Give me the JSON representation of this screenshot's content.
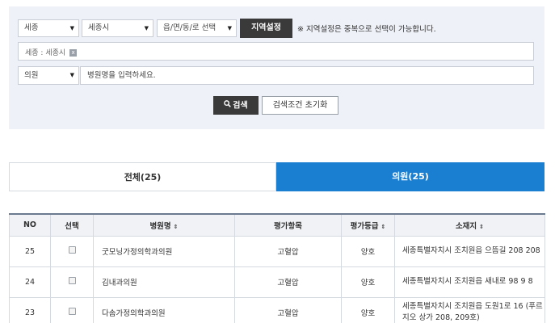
{
  "filters": {
    "sido": "세종",
    "sigungu": "세종시",
    "eupmyeondong": "읍/면/동/로 선택",
    "region_button": "지역설정",
    "note": "※ 지역설정은 중복으로 선택이 가능합니다.",
    "selected_region": "세종 : 세종시",
    "chip_remove": "x",
    "type": "의원",
    "name_placeholder": "병원명을 입력하세요.",
    "search_button": "검색",
    "reset_button": "검색조건 초기화"
  },
  "tabs": [
    {
      "label": "전체(25)"
    },
    {
      "label": "의원(25)"
    }
  ],
  "table": {
    "headers": {
      "no": "NO",
      "select": "선택",
      "name": "병원명",
      "item": "평가항목",
      "grade": "평가등급",
      "address": "소재지"
    },
    "sort_icon": "⇕",
    "rows": [
      {
        "no": "25",
        "name": "굿모닝가정의학과의원",
        "item": "고혈압",
        "grade": "양호",
        "address": "세종특별자치시 조치원읍 으뜸길 208 208"
      },
      {
        "no": "24",
        "name": "김내과의원",
        "item": "고혈압",
        "grade": "양호",
        "address": "세종특별자치시 조치원읍 새내로 98 9 8"
      },
      {
        "no": "23",
        "name": "다솜가정의학과의원",
        "item": "고혈압",
        "grade": "양호",
        "address": "세종특별자치시 조치원읍 도원1로 16 (푸르지오 상가 208, 209호)"
      }
    ]
  },
  "colors": {
    "accent": "#1b7fd1",
    "dark_button": "#3a3a3a",
    "panel_bg": "#eef1f7"
  }
}
